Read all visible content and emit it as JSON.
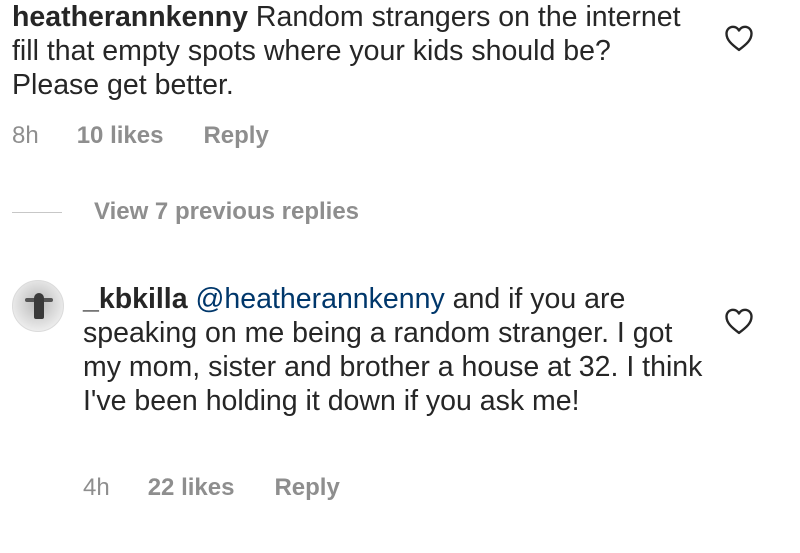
{
  "comments": [
    {
      "username": "heatherannkenny",
      "text": "Random strangers on the internet fill that empty spots where your kids should be? Please get better.",
      "time": "8h",
      "likes": "10 likes",
      "reply_label": "Reply"
    },
    {
      "username": "_kbkilla",
      "mention": "@heatherannkenny",
      "text": "and if you are speaking on me being a random stranger. I got my mom, sister and brother a house at 32. I think I've been holding it down if you ask me!",
      "time": "4h",
      "likes": "22 likes",
      "reply_label": "Reply"
    }
  ],
  "view_replies": {
    "label": "View 7 previous replies"
  },
  "icons": {
    "like": "heart-outline-icon"
  },
  "colors": {
    "text": "#262626",
    "muted": "#8e8e8e",
    "mention": "#00376b"
  }
}
